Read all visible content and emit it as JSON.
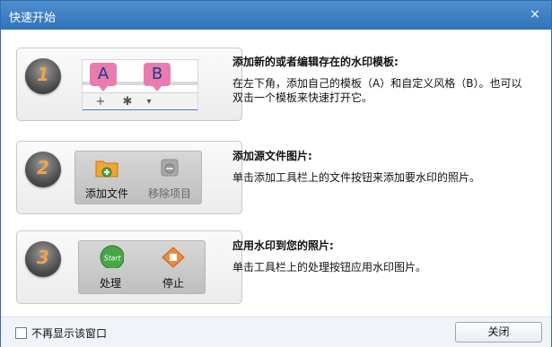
{
  "window": {
    "title": "快速开始",
    "close_glyph": "×"
  },
  "steps": [
    {
      "number": "1",
      "callout_a": "A",
      "callout_b": "B",
      "tool_add": "+",
      "tool_settings": "✱",
      "tool_dropdown": "▾",
      "title": "添加新的或者编辑存在的水印模板:",
      "text": "在左下角，添加自己的模板（A）和自定义风格（B）。也可以双击一个模板来快速打开它。"
    },
    {
      "number": "2",
      "btn_add_files": "添加文件",
      "btn_remove_item": "移除项目",
      "title": "添加源文件图片:",
      "text": "单击添加工具栏上的文件按钮来添加要水印的照片。"
    },
    {
      "number": "3",
      "btn_process": "处理",
      "btn_stop": "停止",
      "start_badge": "Start",
      "title": "应用水印到您的照片:",
      "text": "单击工具栏上的处理按钮应用水印图片。"
    }
  ],
  "footer": {
    "dont_show_label": "不再显示该窗口",
    "close_button": "关闭"
  },
  "colors": {
    "titlebar": "#2f72b8",
    "step_number": "#f3a34a",
    "callout": "#e87cae"
  }
}
